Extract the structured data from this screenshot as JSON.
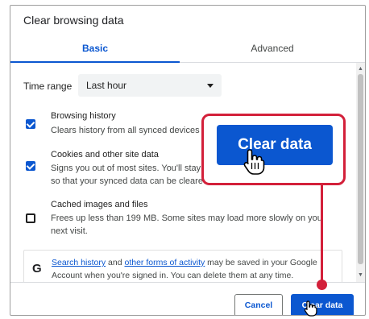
{
  "dialog": {
    "title": "Clear browsing data"
  },
  "tabs": [
    {
      "label": "Basic",
      "active": true
    },
    {
      "label": "Advanced",
      "active": false
    }
  ],
  "time_range": {
    "label": "Time range",
    "value": "Last hour"
  },
  "options": [
    {
      "title": "Browsing history",
      "desc_lines": [
        "Clears history from all synced devices"
      ],
      "checked": true
    },
    {
      "title": "Cookies and other site data",
      "desc_lines": [
        "Signs you out of most sites. You'll stay s",
        "so that your synced data can be cleared"
      ],
      "checked": true
    },
    {
      "title": "Cached images and files",
      "desc_lines": [
        "Frees up less than 199 MB. Some sites may load more slowly on you",
        "next visit."
      ],
      "checked": false
    }
  ],
  "info": {
    "icon": "google-g-icon",
    "link1": "Search history",
    "text1": " and ",
    "link2": "other forms of activity",
    "text2": " may be saved in your Google Account when you're signed in. You can delete them at any time."
  },
  "footer": {
    "cancel_label": "Cancel",
    "clear_label": "Clear data"
  },
  "callout": {
    "label": "Clear data"
  },
  "colors": {
    "accent": "#0b57d0",
    "highlight": "#d3203a"
  }
}
